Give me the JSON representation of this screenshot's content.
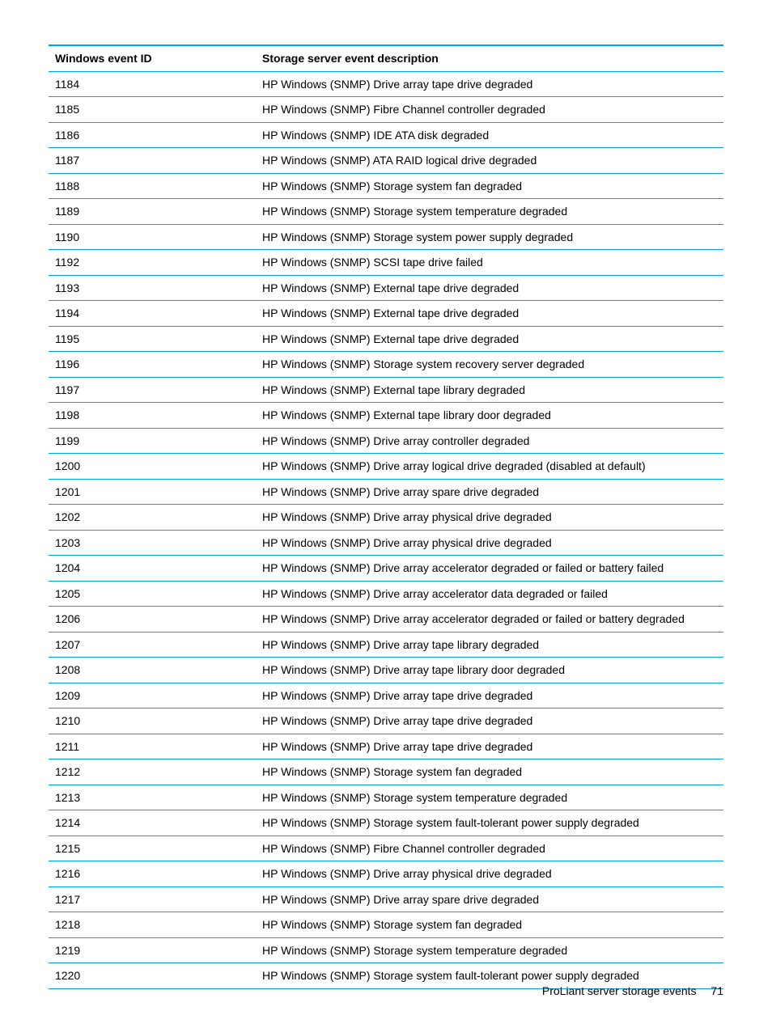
{
  "table": {
    "headers": [
      "Windows event ID",
      "Storage server event description"
    ],
    "rows": [
      [
        "1184",
        "HP Windows (SNMP) Drive array tape drive degraded"
      ],
      [
        "1185",
        "HP Windows (SNMP) Fibre Channel controller degraded"
      ],
      [
        "1186",
        "HP Windows (SNMP) IDE ATA disk degraded"
      ],
      [
        "1187",
        "HP Windows (SNMP) ATA RAID logical drive degraded"
      ],
      [
        "1188",
        "HP Windows (SNMP) Storage system fan degraded"
      ],
      [
        "1189",
        "HP Windows (SNMP) Storage system temperature degraded"
      ],
      [
        "1190",
        "HP Windows (SNMP) Storage system power supply degraded"
      ],
      [
        "1192",
        "HP Windows (SNMP) SCSI tape drive failed"
      ],
      [
        "1193",
        "HP Windows (SNMP) External tape drive degraded"
      ],
      [
        "1194",
        "HP Windows (SNMP) External tape drive degraded"
      ],
      [
        "1195",
        "HP Windows (SNMP) External tape drive degraded"
      ],
      [
        "1196",
        "HP Windows (SNMP) Storage system recovery server degraded"
      ],
      [
        "1197",
        "HP Windows (SNMP) External tape library degraded"
      ],
      [
        "1198",
        "HP Windows (SNMP) External tape library door degraded"
      ],
      [
        "1199",
        "HP Windows (SNMP) Drive array controller degraded"
      ],
      [
        "1200",
        "HP Windows (SNMP) Drive array logical drive degraded (disabled at default)"
      ],
      [
        "1201",
        "HP Windows (SNMP) Drive array spare drive degraded"
      ],
      [
        "1202",
        "HP Windows (SNMP) Drive array physical drive degraded"
      ],
      [
        "1203",
        "HP Windows (SNMP) Drive array physical drive degraded"
      ],
      [
        "1204",
        "HP Windows (SNMP) Drive array accelerator degraded or failed or battery failed"
      ],
      [
        "1205",
        "HP Windows (SNMP) Drive array accelerator data degraded or failed"
      ],
      [
        "1206",
        "HP Windows (SNMP) Drive array accelerator degraded or failed or battery degraded"
      ],
      [
        "1207",
        "HP Windows (SNMP) Drive array tape library degraded"
      ],
      [
        "1208",
        "HP Windows (SNMP) Drive array tape library door degraded"
      ],
      [
        "1209",
        "HP Windows (SNMP) Drive array tape drive degraded"
      ],
      [
        "1210",
        "HP Windows (SNMP) Drive array tape drive degraded"
      ],
      [
        "1211",
        "HP Windows (SNMP) Drive array tape drive degraded"
      ],
      [
        "1212",
        "HP Windows (SNMP) Storage system fan degraded"
      ],
      [
        "1213",
        "HP Windows (SNMP) Storage system temperature degraded"
      ],
      [
        "1214",
        "HP Windows (SNMP) Storage system fault-tolerant power supply degraded"
      ],
      [
        "1215",
        "HP Windows (SNMP) Fibre Channel controller degraded"
      ],
      [
        "1216",
        "HP Windows (SNMP) Drive array physical drive degraded"
      ],
      [
        "1217",
        "HP Windows (SNMP) Drive array spare drive degraded"
      ],
      [
        "1218",
        "HP Windows (SNMP) Storage system fan degraded"
      ],
      [
        "1219",
        "HP Windows (SNMP) Storage system temperature degraded"
      ],
      [
        "1220",
        "HP Windows (SNMP) Storage system fault-tolerant power supply degraded"
      ]
    ]
  },
  "footer": {
    "text": "ProLiant server storage events",
    "page": "71"
  }
}
